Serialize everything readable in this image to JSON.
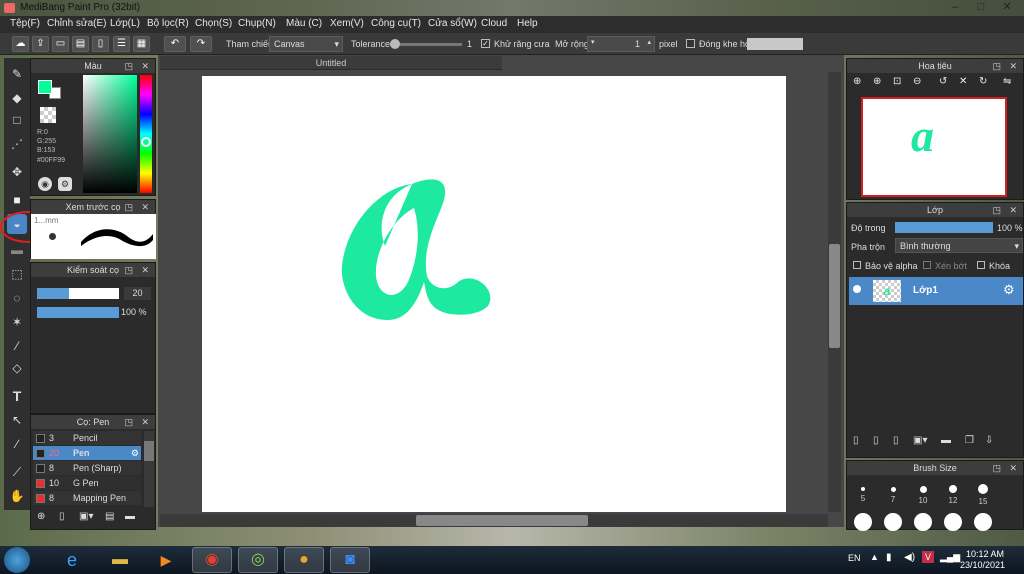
{
  "window": {
    "title": "MediBang Paint Pro (32bit)",
    "controls": [
      "–",
      "□",
      "✕"
    ]
  },
  "menu": [
    "Tệp(F)",
    "Chỉnh sửa(E)",
    "Lớp(L)",
    "Bộ lọc(R)",
    "Chọn(S)",
    "Chụp(N)",
    "Màu (C)",
    "Xem(V)",
    "Công cụ(T)",
    "Cửa sổ(W)",
    "Cloud",
    "Help"
  ],
  "toolbar": {
    "reference_label": "Tham chiếu",
    "reference_value": "Canvas",
    "tolerance_label": "Tolerance",
    "tolerance_value": "1",
    "antialias_label": "Khử răng cưa",
    "antialias_checked": true,
    "expand_label": "Mở rộng",
    "expand_value": "1",
    "expand_unit": "pixel",
    "gap_label": "Đóng khe hở",
    "gap_checked": false
  },
  "color_panel": {
    "title": "Màu",
    "r": "R:0",
    "g": "G:255",
    "b": "B:153",
    "hex": "#00FF99",
    "primary_color": "#00ff99"
  },
  "brush_preview": {
    "title": "Xem trước cọ",
    "size_label": "1...mm"
  },
  "brush_control": {
    "title": "Kiểm soát cọ",
    "size_value": "20",
    "opacity_value": "100 %"
  },
  "brush_list": {
    "title": "Cọ: Pen",
    "items": [
      {
        "num": "3",
        "name": "Pencil",
        "color": "#222222",
        "selected": false
      },
      {
        "num": "20",
        "name": "Pen",
        "color": "#222222",
        "selected": true
      },
      {
        "num": "8",
        "name": "Pen (Sharp)",
        "color": "#222222",
        "selected": false
      },
      {
        "num": "10",
        "name": "G Pen",
        "color": "#e83030",
        "selected": false
      },
      {
        "num": "8",
        "name": "Mapping Pen",
        "color": "#e83030",
        "selected": false
      }
    ]
  },
  "document": {
    "tab_title": "Untitled",
    "stroke_color": "#1de9a0"
  },
  "navigator": {
    "title": "Hoa tiêu"
  },
  "layer_panel": {
    "title": "Lớp",
    "opacity_label": "Độ trong",
    "opacity_value": "100 %",
    "blend_label": "Pha trộn",
    "blend_value": "Bình thường",
    "protect_alpha": "Bảo vệ alpha",
    "clipping": "Xén bớt",
    "lock": "Khóa",
    "layer_name": "Lớp1"
  },
  "brush_size_panel": {
    "title": "Brush Size",
    "sizes": [
      "5",
      "7",
      "10",
      "12",
      "15"
    ]
  },
  "taskbar": {
    "language": "EN",
    "time": "10:12 AM",
    "date": "23/10/2021"
  }
}
